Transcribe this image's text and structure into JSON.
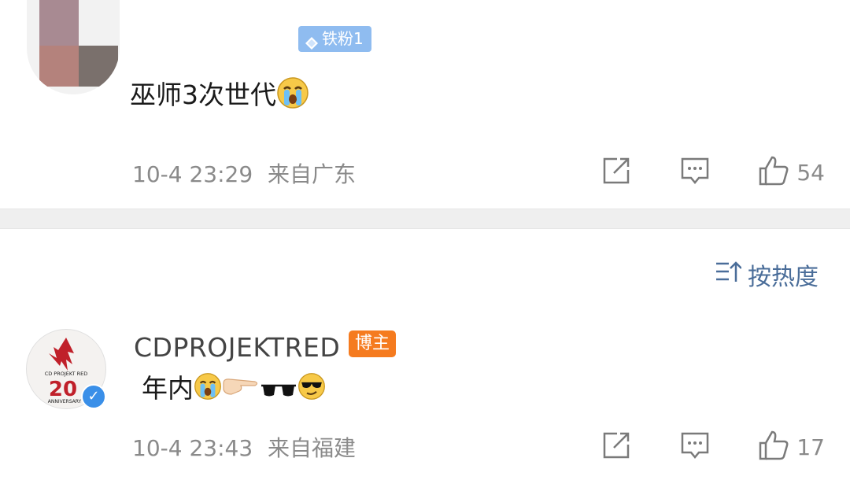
{
  "comments": [
    {
      "username": "",
      "badge": "铁粉1",
      "text": "巫师3次世代",
      "emojis": [
        "crying-face"
      ],
      "time": "10-4 23:29",
      "location": "来自广东",
      "likes": "54"
    },
    {
      "username": "CDPROJEKTRED",
      "badge": "博主",
      "text": "年内",
      "emojis": [
        "crying-face",
        "pointing-right",
        "sunglasses",
        "cool-face"
      ],
      "avatar_text_top": "CD PROJEKT RED",
      "avatar_text_mid": "20",
      "avatar_text_bottom": "ANNIVERSARY",
      "time": "10-4 23:43",
      "location": "来自福建",
      "likes": "17"
    }
  ],
  "sort": {
    "label": "按热度"
  },
  "colors": {
    "accent": "#4a6d99",
    "muted": "#8a8a8a",
    "host_badge": "#f57b1f",
    "fan_badge": "#8fbcf0"
  }
}
